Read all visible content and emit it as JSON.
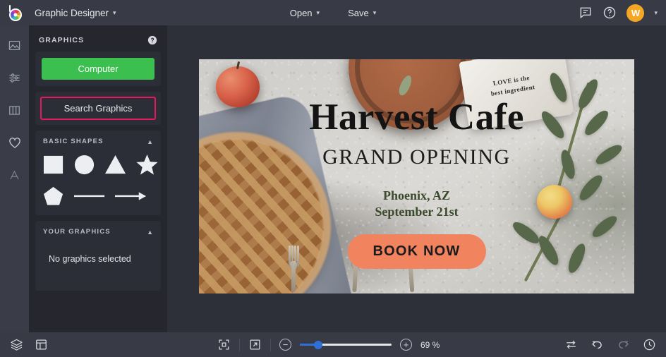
{
  "topbar": {
    "logo_icon": "bonfire-color-wheel-logo",
    "app_title": "Graphic Designer",
    "caret": "⌄",
    "open_label": "Open",
    "save_label": "Save",
    "chat_icon": "chat-bubble-icon",
    "help_icon": "question-circle-icon",
    "avatar_initial": "W",
    "avatar_color": "#f5a623"
  },
  "rail": {
    "items": [
      {
        "icon": "image-icon",
        "name": "rail-item-images"
      },
      {
        "icon": "sliders-icon",
        "name": "rail-item-adjustments"
      },
      {
        "icon": "columns-icon",
        "name": "rail-item-layouts"
      },
      {
        "icon": "heart-icon",
        "name": "rail-item-graphics"
      },
      {
        "icon": "text-a-icon",
        "name": "rail-item-text"
      }
    ]
  },
  "panel": {
    "title": "GRAPHICS",
    "help_icon": "question-circle-icon",
    "computer_button": "Computer",
    "computer_button_color": "#3bbf4f",
    "search_button": "Search Graphics",
    "search_button_highlight_color": "#e8185e",
    "basic_shapes": {
      "title": "BASIC SHAPES",
      "collapse_icon": "chevron-up-icon",
      "shapes": [
        {
          "name": "square-shape",
          "label": "Square"
        },
        {
          "name": "circle-shape",
          "label": "Circle"
        },
        {
          "name": "triangle-shape",
          "label": "Triangle"
        },
        {
          "name": "star-shape",
          "label": "Star"
        },
        {
          "name": "pentagon-shape",
          "label": "Pentagon"
        },
        {
          "name": "line-shape",
          "label": "Line"
        },
        {
          "name": "arrow-shape",
          "label": "Arrow"
        }
      ]
    },
    "your_graphics": {
      "title": "YOUR GRAPHICS",
      "collapse_icon": "chevron-up-icon",
      "empty_message": "No graphics selected"
    }
  },
  "artboard": {
    "title": "Harvest Cafe",
    "subtitle": "GRAND OPENING",
    "location": "Phoenix, AZ",
    "date": "September 21st",
    "cta_label": "BOOK NOW",
    "cta_color": "#f1845f",
    "napkin_text_line1": "LOVE is the",
    "napkin_text_line2": "best ingredient",
    "location_color": "#3a4a2c"
  },
  "bottombar": {
    "layers_icon": "layers-icon",
    "layout_icon": "layout-panel-icon",
    "fit_icon": "fit-to-screen-icon",
    "expand_icon": "expand-arrow-icon",
    "zoom_out_icon": "minus-icon",
    "zoom_in_icon": "plus-icon",
    "zoom_level": "69 %",
    "slider_percent": 20,
    "swap_icon": "swap-arrows-icon",
    "undo_icon": "undo-arrow-icon",
    "redo_icon": "redo-arrow-icon",
    "history_icon": "clock-history-icon"
  }
}
